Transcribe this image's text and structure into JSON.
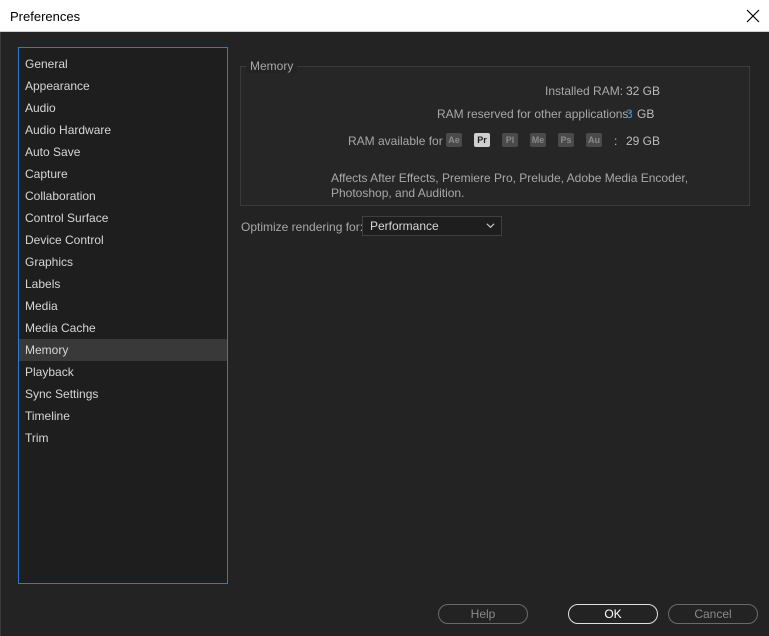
{
  "window": {
    "title": "Preferences",
    "close_icon": "close-icon"
  },
  "sidebar": {
    "items": [
      {
        "label": "General"
      },
      {
        "label": "Appearance"
      },
      {
        "label": "Audio"
      },
      {
        "label": "Audio Hardware"
      },
      {
        "label": "Auto Save"
      },
      {
        "label": "Capture"
      },
      {
        "label": "Collaboration"
      },
      {
        "label": "Control Surface"
      },
      {
        "label": "Device Control"
      },
      {
        "label": "Graphics"
      },
      {
        "label": "Labels"
      },
      {
        "label": "Media"
      },
      {
        "label": "Media Cache"
      },
      {
        "label": "Memory",
        "selected": true
      },
      {
        "label": "Playback"
      },
      {
        "label": "Sync Settings"
      },
      {
        "label": "Timeline"
      },
      {
        "label": "Trim"
      }
    ]
  },
  "memory": {
    "legend": "Memory",
    "installed_ram_label": "Installed RAM:",
    "installed_ram_value": "32 GB",
    "reserved_label": "RAM reserved for other applications:",
    "reserved_value": "3",
    "reserved_unit": "GB",
    "available_label": "RAM available for",
    "apps": [
      "Ae",
      "Pr",
      "Pl",
      "Me",
      "Ps",
      "Au"
    ],
    "active_app": "Pr",
    "available_separator": ":",
    "available_value": "29 GB",
    "note": "Affects After Effects, Premiere Pro, Prelude, Adobe Media Encoder, Photoshop, and Audition."
  },
  "optimize": {
    "label": "Optimize rendering for:",
    "selected": "Performance"
  },
  "buttons": {
    "help": "Help",
    "ok": "OK",
    "cancel": "Cancel"
  },
  "colors": {
    "accent": "#2d7ad6",
    "link": "#3d8fe8",
    "background": "#232323"
  }
}
